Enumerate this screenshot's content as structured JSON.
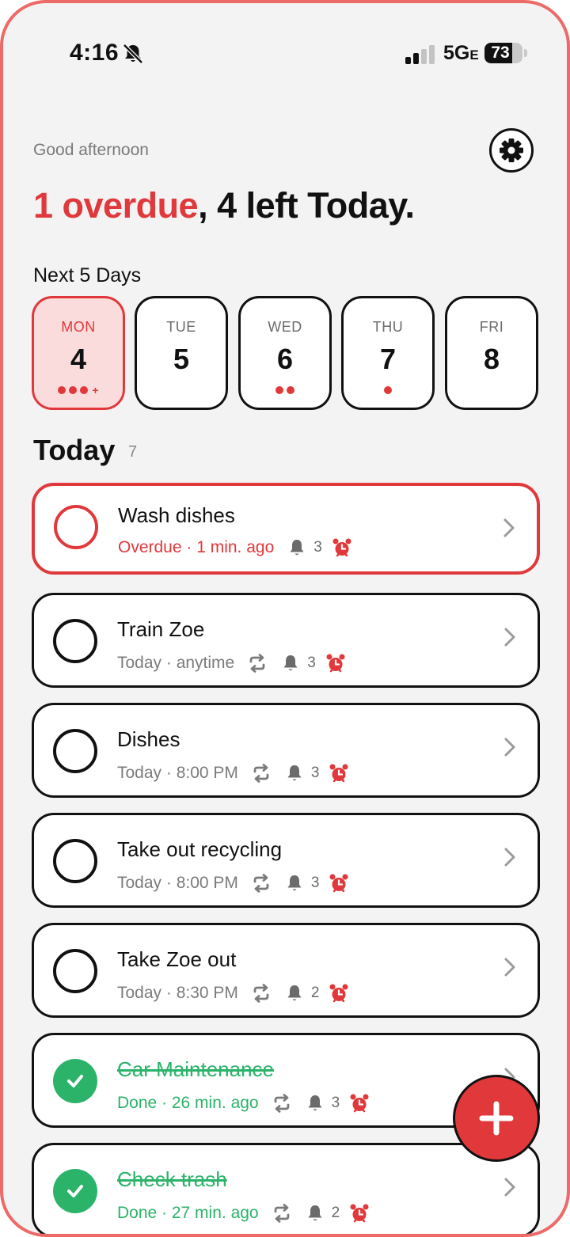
{
  "status_bar": {
    "time": "4:16",
    "network": "5G",
    "network_suffix": "E",
    "battery": "73",
    "battery_level": 0.73
  },
  "header": {
    "greeting": "Good afternoon",
    "overdue_text": "1 overdue",
    "rest_text": ", 4 left Today."
  },
  "next_days": {
    "label": "Next 5 Days",
    "days": [
      {
        "name": "MON",
        "num": "4",
        "dots": 3,
        "more": "+"
      },
      {
        "name": "TUE",
        "num": "5",
        "dots": 0,
        "more": ""
      },
      {
        "name": "WED",
        "num": "6",
        "dots": 2,
        "more": ""
      },
      {
        "name": "THU",
        "num": "7",
        "dots": 1,
        "more": ""
      },
      {
        "name": "FRI",
        "num": "8",
        "dots": 0,
        "more": ""
      }
    ]
  },
  "today": {
    "title": "Today",
    "count": "7",
    "tasks": [
      {
        "title": "Wash dishes",
        "meta": "Overdue · 1 min. ago",
        "reminders": "3",
        "status": "overdue",
        "repeat": false
      },
      {
        "title": "Train Zoe",
        "meta": "Today · anytime",
        "reminders": "3",
        "status": "open",
        "repeat": true
      },
      {
        "title": "Dishes",
        "meta": "Today · 8:00 PM",
        "reminders": "3",
        "status": "open",
        "repeat": true
      },
      {
        "title": "Take out recycling",
        "meta": "Today · 8:00 PM",
        "reminders": "3",
        "status": "open",
        "repeat": true
      },
      {
        "title": "Take Zoe out",
        "meta": "Today · 8:30 PM",
        "reminders": "2",
        "status": "open",
        "repeat": true
      },
      {
        "title": "Car Maintenance",
        "meta": "Done · 26 min. ago",
        "reminders": "3",
        "status": "done",
        "repeat": true
      },
      {
        "title": "Check trash",
        "meta": "Done · 27 min. ago",
        "reminders": "2",
        "status": "done",
        "repeat": true
      }
    ]
  },
  "colors": {
    "accent": "#e0383b",
    "done": "#2cb36a",
    "muted": "#7b7b7b"
  },
  "icons": {
    "settings": "gear-icon",
    "add": "plus-icon",
    "repeat": "repeat-icon",
    "reminder": "bell-icon",
    "alarm": "alarm-clock-icon",
    "open": "chevron-right-icon"
  }
}
